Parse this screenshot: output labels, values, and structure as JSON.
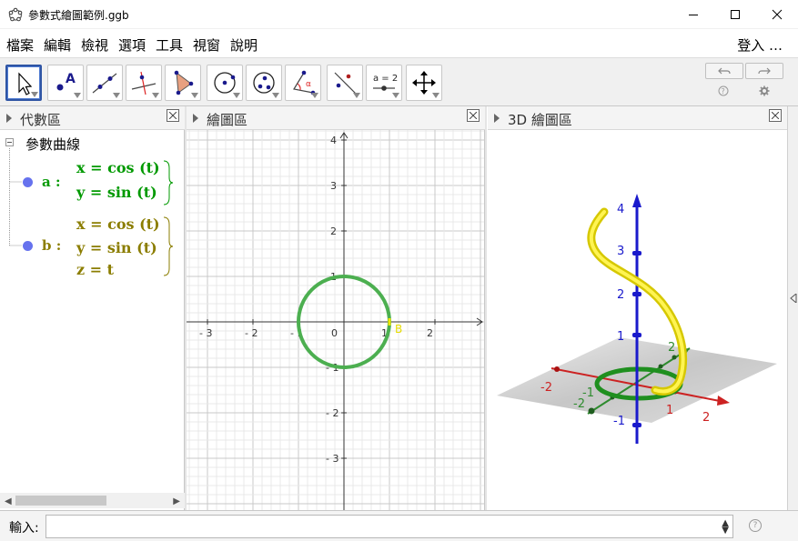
{
  "window": {
    "title": "參數式繪圖範例.ggb"
  },
  "menu": {
    "items": [
      "檔案",
      "編輯",
      "檢視",
      "選項",
      "工具",
      "視窗",
      "說明"
    ],
    "login": "登入 …"
  },
  "toolbar": {
    "tools": [
      "move",
      "point",
      "line",
      "perpendicular-line",
      "polygon",
      "circle-center-point",
      "circle-three-points",
      "angle",
      "reflect",
      "slider",
      "move-graphics-view"
    ],
    "slider_label": "a = 2"
  },
  "panels": {
    "algebra_title": "代數區",
    "graphics_title": "繪圖區",
    "graphics3d_title": "3D 繪圖區"
  },
  "algebra": {
    "group_label": "參數曲線",
    "objects": [
      {
        "name": "a :",
        "color": "#009900",
        "lines": [
          "x = cos (t)",
          "y = sin (t)"
        ]
      },
      {
        "name": "b :",
        "color": "#8b7d00",
        "lines": [
          "x = cos (t)",
          "y = sin (t)",
          "z = t"
        ]
      }
    ]
  },
  "graphics2d": {
    "x_ticks": [
      "3",
      "2",
      "1",
      "0",
      "1",
      "2"
    ],
    "x_tick_signs": [
      "-",
      "-",
      "-",
      "",
      "",
      ""
    ],
    "y_ticks": [
      "4",
      "3",
      "2",
      "1",
      "1",
      "2",
      "3"
    ],
    "y_tick_signs": [
      "",
      "",
      "",
      "",
      "-",
      "-",
      "-"
    ],
    "point_label": "B",
    "circle_color": "#4caf50"
  },
  "graphics3d": {
    "z_ticks": [
      "4",
      "3",
      "2",
      "1",
      "-1"
    ],
    "x_ticks": [
      "-2",
      "1",
      "2"
    ],
    "y_ticks": [
      "2",
      "-1",
      "-2"
    ],
    "helix_color": "#f2e600"
  },
  "inputbar": {
    "label": "輸入:",
    "value": "",
    "placeholder": ""
  }
}
